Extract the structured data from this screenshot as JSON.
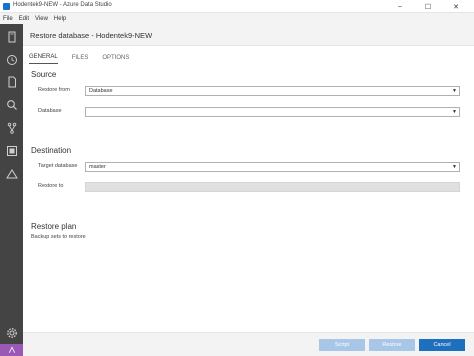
{
  "window": {
    "title": "Hodentek9-NEW - Azure Data Studio",
    "minimize": "–",
    "maximize": "☐",
    "close": "✕"
  },
  "menu": [
    "File",
    "Edit",
    "View",
    "Help"
  ],
  "activity_icons": [
    "servers-icon",
    "history-icon",
    "file-icon",
    "search-icon",
    "source-control-icon",
    "extensions-icon",
    "azure-icon"
  ],
  "dialog": {
    "title": "Restore database - Hodentek9-NEW"
  },
  "tabs": [
    {
      "label": "GENERAL",
      "active": true
    },
    {
      "label": "FILES",
      "active": false
    },
    {
      "label": "OPTIONS",
      "active": false
    }
  ],
  "source": {
    "heading": "Source",
    "restore_from_label": "Restore from",
    "restore_from_value": "Database",
    "database_label": "Database",
    "database_value": ""
  },
  "destination": {
    "heading": "Destination",
    "target_db_label": "Target database",
    "target_db_value": "master",
    "restore_to_label": "Restore to",
    "restore_to_value": ""
  },
  "restore_plan": {
    "heading": "Restore plan",
    "subtext": "Backup sets to restore"
  },
  "footer": {
    "script_label": "Script",
    "restore_label": "Restore",
    "cancel_label": "Cancel"
  },
  "colors": {
    "activity_bar": "#444444",
    "accent": "#1f6fbf",
    "disabled_button": "#a8c7e8"
  }
}
